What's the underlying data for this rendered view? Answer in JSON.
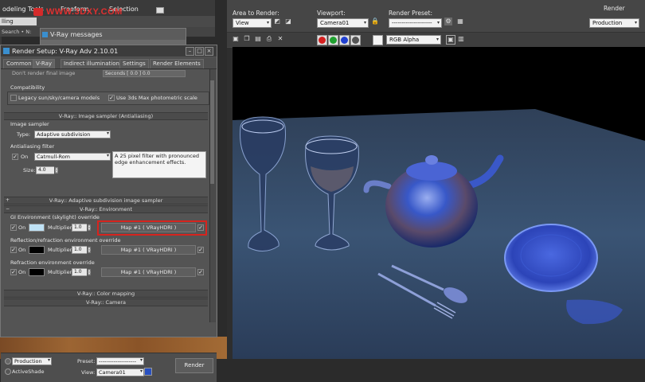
{
  "host": {
    "tabs": [
      "odeling Tools",
      "Freeform",
      "Selection"
    ],
    "watermark": "WWW.3DXY.COM",
    "ribbon_label": "lling",
    "menu_text": "Search • N:"
  },
  "messages_window": {
    "title": "V-Ray messages"
  },
  "render_setup": {
    "title": "Render Setup: V-Ray Adv 2.10.01",
    "tabs": [
      "Common",
      "V-Ray",
      "Indirect illumination",
      "Settings",
      "Render Elements"
    ],
    "cut_row_label": "Don't render final image",
    "cut_row_field": "Seconds [ 0.0 ] 0.0",
    "compatibility": {
      "header": "Compatibility",
      "legacy_label": "Legacy sun/sky/camera models",
      "photometric_label": "Use 3ds Max photometric scale",
      "legacy_checked": false,
      "photometric_checked": true
    },
    "image_sampler": {
      "section": "V-Ray:: Image sampler (Antialiasing)",
      "header": "Image sampler",
      "type_label": "Type:",
      "type_value": "Adaptive subdivision",
      "aa_header": "Antialiasing filter",
      "on_label": "On",
      "filter_value": "Catmull-Rom",
      "size_label": "Size:",
      "size_value": "4.0",
      "description": "A 25 pixel filter with pronounced edge enhancement effects."
    },
    "adaptive_section": "V-Ray:: Adaptive subdivision image sampler",
    "environment": {
      "section": "V-Ray:: Environment",
      "gi_header": "GI Environment (skylight) override",
      "reflection_header": "Reflection/refraction environment override",
      "refraction_header": "Refraction environment override",
      "on_label": "On",
      "multiplier_label": "Multiplier:",
      "rows": [
        {
          "multiplier": "1.0",
          "map": "Map #1 ( VRayHDRI )",
          "swatch_color": "#bfe2f5",
          "highlighted": true
        },
        {
          "multiplier": "1.0",
          "map": "Map #1 ( VRayHDRI )",
          "swatch_color": "#000000",
          "highlighted": false
        },
        {
          "multiplier": "1.0",
          "map": "Map #1 ( VRayHDRI )",
          "swatch_color": "#000000",
          "highlighted": false
        }
      ],
      "highlight_color": "#d6241e"
    },
    "color_mapping_section": "V-Ray:: Color mapping",
    "camera_section": "V-Ray:: Camera",
    "bottom": {
      "mode_value": "Production",
      "activeshade_label": "ActiveShade",
      "preset_label": "Preset:",
      "preset_value": "--------------------",
      "view_label": "View:",
      "view_value": "Camera01",
      "render_button": "Render"
    }
  },
  "frame_buffer": {
    "area_label": "Area to Render:",
    "area_value": "View",
    "viewport_label": "Viewport:",
    "viewport_value": "Camera01",
    "preset_label": "Render Preset:",
    "preset_value": "--------------------",
    "render_button": "Render",
    "mode_value": "Production",
    "channel_value": "RGB Alpha",
    "channel_colors": {
      "red": "#d42020",
      "green": "#20a030",
      "blue": "#2040d0"
    }
  }
}
